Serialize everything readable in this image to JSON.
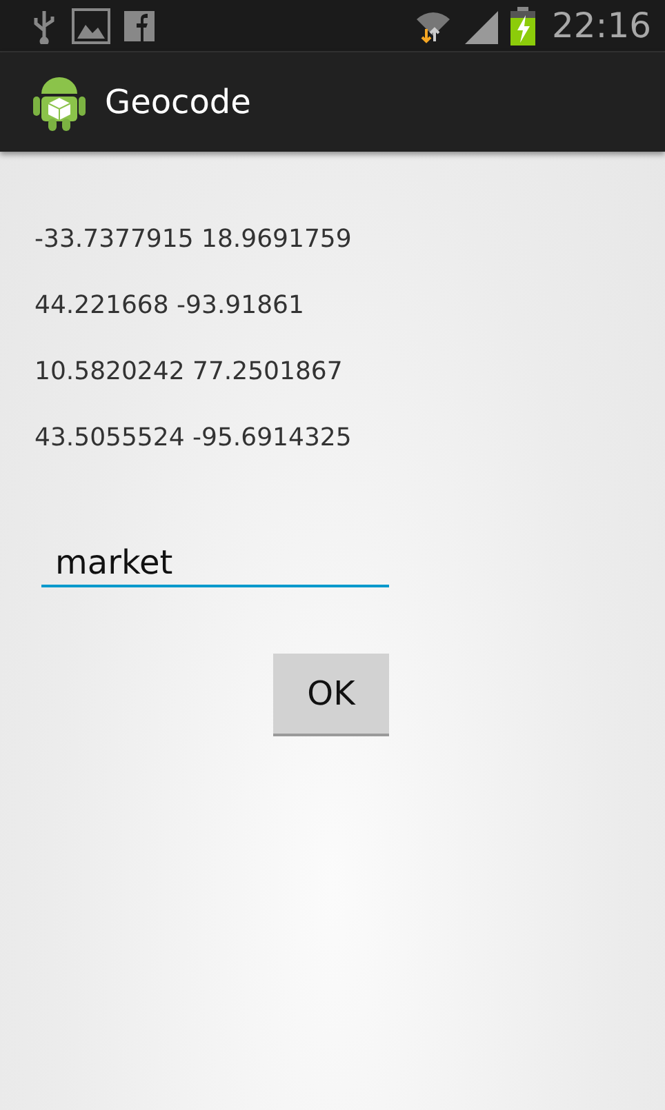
{
  "status_bar": {
    "time": "22:16"
  },
  "action_bar": {
    "title": "Geocode"
  },
  "results": [
    "-33.7377915 18.9691759",
    "44.221668 -93.91861",
    "10.5820242 77.2501867",
    "43.5055524 -95.6914325"
  ],
  "query_field": {
    "value": "market",
    "focused": true
  },
  "ok_button": {
    "label": "OK"
  }
}
